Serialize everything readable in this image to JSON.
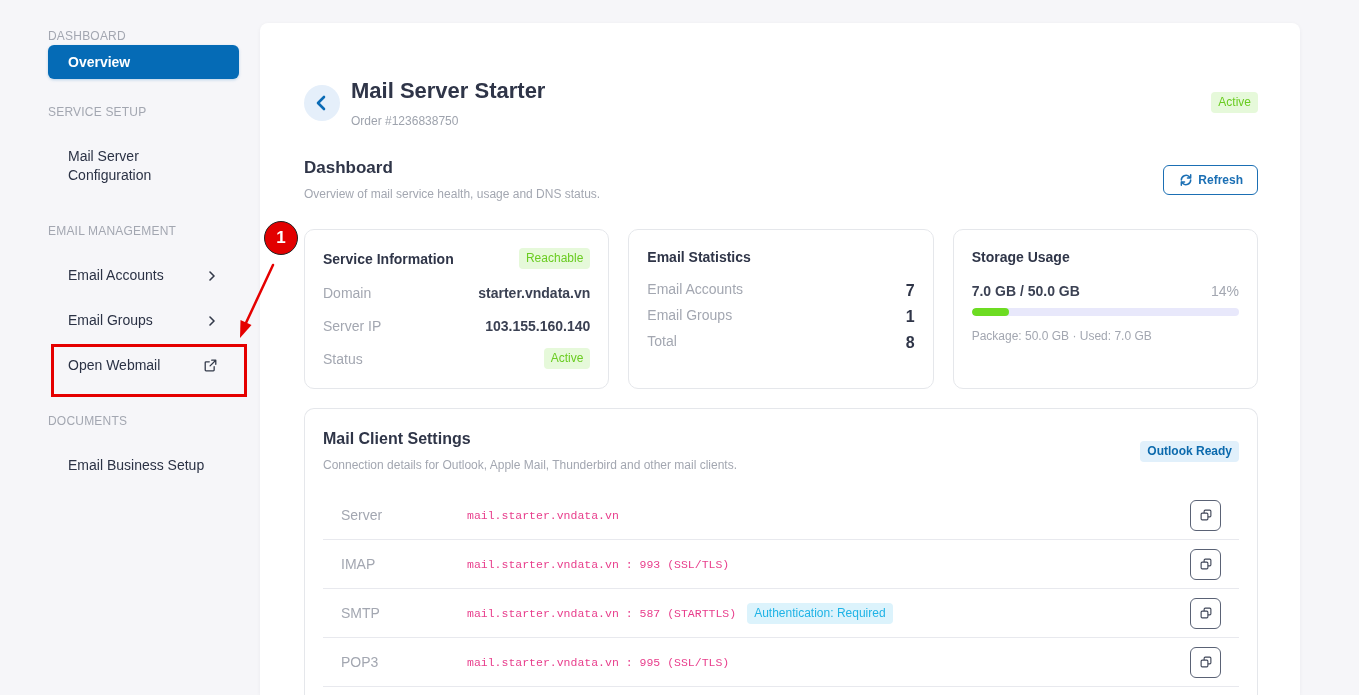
{
  "sidebar": {
    "sections": [
      {
        "heading": "DASHBOARD",
        "items": [
          {
            "label": "Overview",
            "kind": "plain",
            "selected": true
          }
        ]
      },
      {
        "heading": "SERVICE SETUP",
        "items": [
          {
            "label": "Mail Server Configuration",
            "kind": "plain",
            "selected": false
          }
        ]
      },
      {
        "heading": "EMAIL MANAGEMENT",
        "items": [
          {
            "label": "Email Accounts",
            "kind": "submenu",
            "selected": false
          },
          {
            "label": "Email Groups",
            "kind": "submenu",
            "selected": false
          },
          {
            "label": "Open Webmail",
            "kind": "external",
            "selected": false
          }
        ]
      },
      {
        "heading": "DOCUMENTS",
        "items": [
          {
            "label": "Email Business Setup",
            "kind": "plain",
            "selected": false
          }
        ]
      }
    ]
  },
  "annotation": {
    "number": "1"
  },
  "header": {
    "title": "Mail Server Starter",
    "order": "Order #1236838750",
    "status": "Active"
  },
  "dashboard": {
    "title": "Dashboard",
    "subtitle": "Overview of mail service health, usage and DNS status.",
    "refresh_button": "Refresh"
  },
  "cards": [
    {
      "kind": "service",
      "title": "Service Information",
      "badge": "Reachable",
      "rows": [
        {
          "kind": "text",
          "label": "Domain",
          "value": "starter.vndata.vn"
        },
        {
          "kind": "text",
          "label": "Server IP",
          "value": "103.155.160.140"
        },
        {
          "kind": "badge",
          "label": "Status",
          "value": "Active"
        }
      ]
    },
    {
      "kind": "stats",
      "title": "Email Statistics",
      "rows": [
        {
          "label": "Email Accounts",
          "value": "7"
        },
        {
          "label": "Email Groups",
          "value": "1"
        },
        {
          "label": "Total",
          "value": "8"
        }
      ]
    },
    {
      "kind": "storage",
      "title": "Storage Usage",
      "usage": "7.0 GB / 50.0 GB",
      "percent": "14%",
      "level": 0.14,
      "note": "Package: 50.0 GB · Used: 7.0 GB"
    }
  ],
  "mail_client_settings": {
    "title": "Mail Client Settings",
    "subtitle": "Connection details for Outlook, Apple Mail, Thunderbird and other mail clients.",
    "badge": "Outlook Ready",
    "rows": [
      {
        "label": "Server",
        "value": "mail.starter.vndata.vn"
      },
      {
        "label": "IMAP",
        "value": "mail.starter.vndata.vn : 993 (SSL/TLS)"
      },
      {
        "label": "SMTP",
        "value": "mail.starter.vndata.vn : 587 (STARTTLS)",
        "tag": "Authentication: Required"
      },
      {
        "label": "POP3",
        "value": "mail.starter.vndata.vn : 995 (SSL/TLS)"
      }
    ]
  }
}
